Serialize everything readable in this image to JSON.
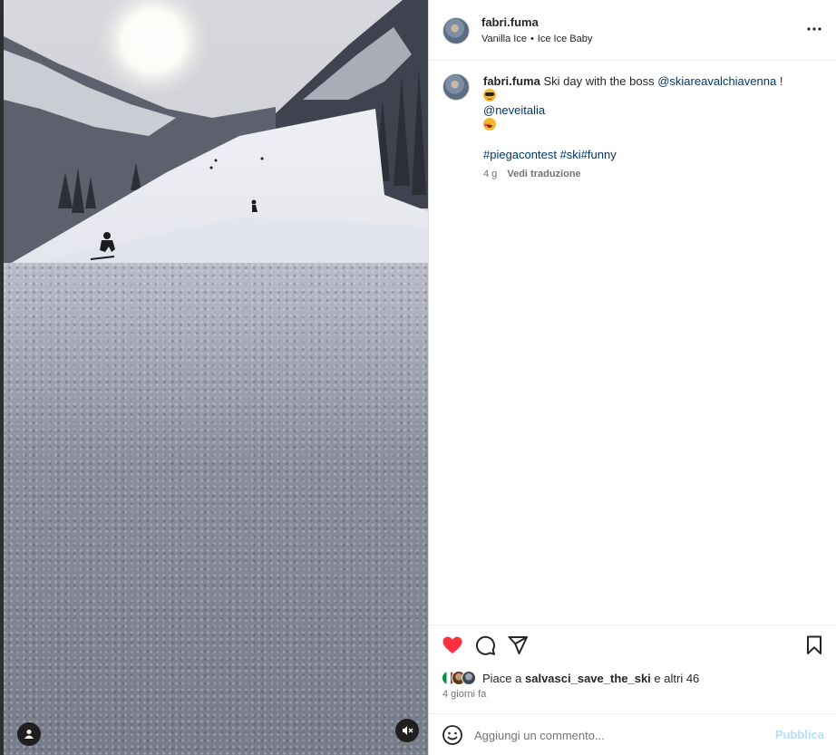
{
  "post": {
    "username": "fabri.fuma",
    "audio_artist": "Vanilla Ice",
    "audio_separator": "•",
    "audio_track": "Ice Ice Baby"
  },
  "caption": {
    "username": "fabri.fuma",
    "text_before": "Ski day with the boss",
    "mention_1": "@skiareavalchiavenna",
    "text_after": "!",
    "emoji_1": "smiling-face-with-sunglasses",
    "mention_2": "@neveitalia",
    "emoji_2": "smiling-face-with-heart-eyes",
    "hashtag_1": "#piegacontest",
    "hashtag_2": "#ski",
    "hashtag_3": "#funny",
    "age": "4 g",
    "translate_label": "Vedi traduzione"
  },
  "actions": {
    "liked": true,
    "like_color": "#ff3040"
  },
  "likes": {
    "prefix": "Piace a",
    "user": "salvasci_save_the_ski",
    "suffix": "e altri 46"
  },
  "posted_label": "4 giorni fa",
  "comment": {
    "placeholder": "Aggiungi un commento...",
    "publish_label": "Pubblica"
  },
  "icons": {
    "more": "more-horizontal-icon",
    "like": "heart-icon",
    "comment": "comment-icon",
    "share": "paper-plane-icon",
    "save": "bookmark-icon",
    "emoji": "emoji-smile-icon",
    "user_tag": "user-tag-icon",
    "mute": "audio-muted-icon"
  }
}
